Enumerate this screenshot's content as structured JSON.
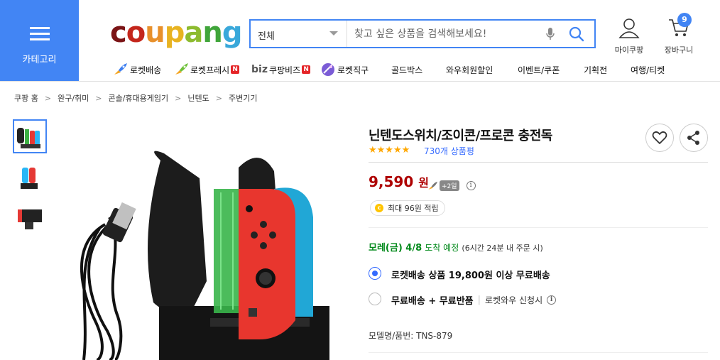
{
  "header": {
    "category_label": "카테고리",
    "logo_letters": [
      {
        "ch": "c",
        "color": "#7b1416"
      },
      {
        "ch": "o",
        "color": "#c4261c"
      },
      {
        "ch": "u",
        "color": "#e8902b"
      },
      {
        "ch": "p",
        "color": "#e8b321"
      },
      {
        "ch": "a",
        "color": "#8dbb2f"
      },
      {
        "ch": "n",
        "color": "#40a53a"
      },
      {
        "ch": "g",
        "color": "#39a8da"
      }
    ],
    "search": {
      "category": "전체",
      "placeholder": "찾고 싶은 상품을 검색해보세요!"
    },
    "my_coupang": "마이쿠팡",
    "cart": "장바구니",
    "cart_count": "9"
  },
  "nav": [
    {
      "label": "로켓배송",
      "icon": "rocket-blue-icon"
    },
    {
      "label": "로켓프레시",
      "icon": "rocket-green-icon",
      "badge": "N"
    },
    {
      "label": "쿠팡비즈",
      "prefix": "biz",
      "badge": "N"
    },
    {
      "label": "로켓직구",
      "icon": "rocket-global-icon"
    },
    {
      "label": "골드박스"
    },
    {
      "label": "와우회원할인"
    },
    {
      "label": "이벤트/쿠폰"
    },
    {
      "label": "기획전"
    },
    {
      "label": "여행/티켓"
    }
  ],
  "breadcrumb": [
    "쿠팡 홈",
    "완구/취미",
    "콘솔/휴대용게임기",
    "닌텐도",
    "주변기기"
  ],
  "product": {
    "title": "닌텐도스위치/조이콘/프로콘 충전독",
    "stars": "★★★★★",
    "rating_fraction": 1.0,
    "review_count": "730개 상품평",
    "price": "9,590",
    "price_unit": "원",
    "rocket_tag": "+2일",
    "cashback": "최대 96원 적립",
    "delivery": {
      "date": "모레(금) 4/8",
      "arrive": "도착 예정",
      "note": "(6시간 24분 내 주문 시)"
    },
    "shipping_options": [
      {
        "label": "로켓배송 상품 19,800원 이상 무료배송",
        "selected": true
      },
      {
        "label": "무료배송 + 무료반품",
        "sub": "로켓와우 신청시",
        "selected": false
      }
    ],
    "model_label": "모델명/품번:",
    "model_value": "TNS-879"
  },
  "colors": {
    "accent": "#4285f4",
    "price": "#ae0000",
    "link": "#346aff",
    "delivery": "#00891a"
  }
}
